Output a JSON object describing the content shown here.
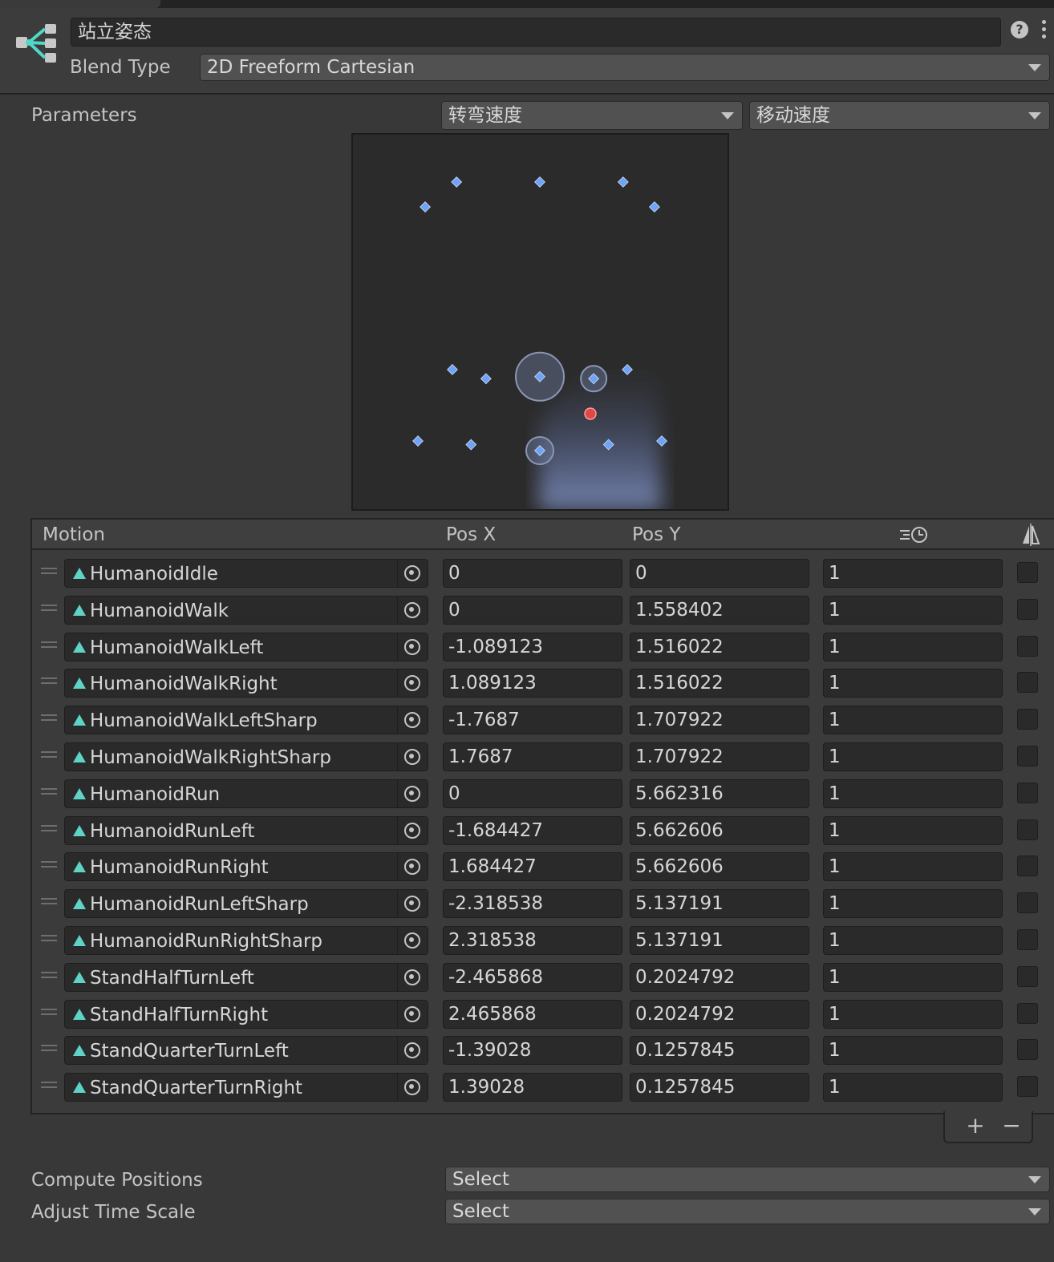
{
  "header": {
    "state_name": "站立姿态",
    "blend_type_label": "Blend Type",
    "blend_type_value": "2D Freeform Cartesian",
    "help_icon_glyph": "?"
  },
  "parameters": {
    "label": "Parameters",
    "x_param": "转弯速度",
    "y_param": "移动速度"
  },
  "list": {
    "columns": {
      "motion": "Motion",
      "pos_x": "Pos X",
      "pos_y": "Pos Y",
      "time_scale_icon": "time-scale-icon",
      "mirror_icon": "mirror-icon"
    },
    "rows": [
      {
        "motion": "HumanoidIdle",
        "pos_x": "0",
        "pos_y": "0",
        "time_scale": "1"
      },
      {
        "motion": "HumanoidWalk",
        "pos_x": "0",
        "pos_y": "1.558402",
        "time_scale": "1"
      },
      {
        "motion": "HumanoidWalkLeft",
        "pos_x": "-1.089123",
        "pos_y": "1.516022",
        "time_scale": "1"
      },
      {
        "motion": "HumanoidWalkRight",
        "pos_x": "1.089123",
        "pos_y": "1.516022",
        "time_scale": "1"
      },
      {
        "motion": "HumanoidWalkLeftSharp",
        "pos_x": "-1.7687",
        "pos_y": "1.707922",
        "time_scale": "1"
      },
      {
        "motion": "HumanoidWalkRightSharp",
        "pos_x": "1.7687",
        "pos_y": "1.707922",
        "time_scale": "1"
      },
      {
        "motion": "HumanoidRun",
        "pos_x": "0",
        "pos_y": "5.662316",
        "time_scale": "1"
      },
      {
        "motion": "HumanoidRunLeft",
        "pos_x": "-1.684427",
        "pos_y": "5.662606",
        "time_scale": "1"
      },
      {
        "motion": "HumanoidRunRight",
        "pos_x": "1.684427",
        "pos_y": "5.662606",
        "time_scale": "1"
      },
      {
        "motion": "HumanoidRunLeftSharp",
        "pos_x": "-2.318538",
        "pos_y": "5.137191",
        "time_scale": "1"
      },
      {
        "motion": "HumanoidRunRightSharp",
        "pos_x": "2.318538",
        "pos_y": "5.137191",
        "time_scale": "1"
      },
      {
        "motion": "StandHalfTurnLeft",
        "pos_x": "-2.465868",
        "pos_y": "0.2024792",
        "time_scale": "1"
      },
      {
        "motion": "StandHalfTurnRight",
        "pos_x": "2.465868",
        "pos_y": "0.2024792",
        "time_scale": "1"
      },
      {
        "motion": "StandQuarterTurnLeft",
        "pos_x": "-1.39028",
        "pos_y": "0.1257845",
        "time_scale": "1"
      },
      {
        "motion": "StandQuarterTurnRight",
        "pos_x": "1.39028",
        "pos_y": "0.1257845",
        "time_scale": "1"
      }
    ],
    "add_glyph": "+",
    "remove_glyph": "−"
  },
  "footer": {
    "compute_positions_label": "Compute Positions",
    "compute_positions_value": "Select",
    "adjust_time_scale_label": "Adjust Time Scale",
    "adjust_time_scale_value": "Select"
  },
  "colors": {
    "background": "#383838",
    "field": "#2a2a2a",
    "dropdown": "#515151",
    "point": "#6ea3f5",
    "current_param": "#e04848",
    "clip_icon": "#5fd3c6"
  }
}
